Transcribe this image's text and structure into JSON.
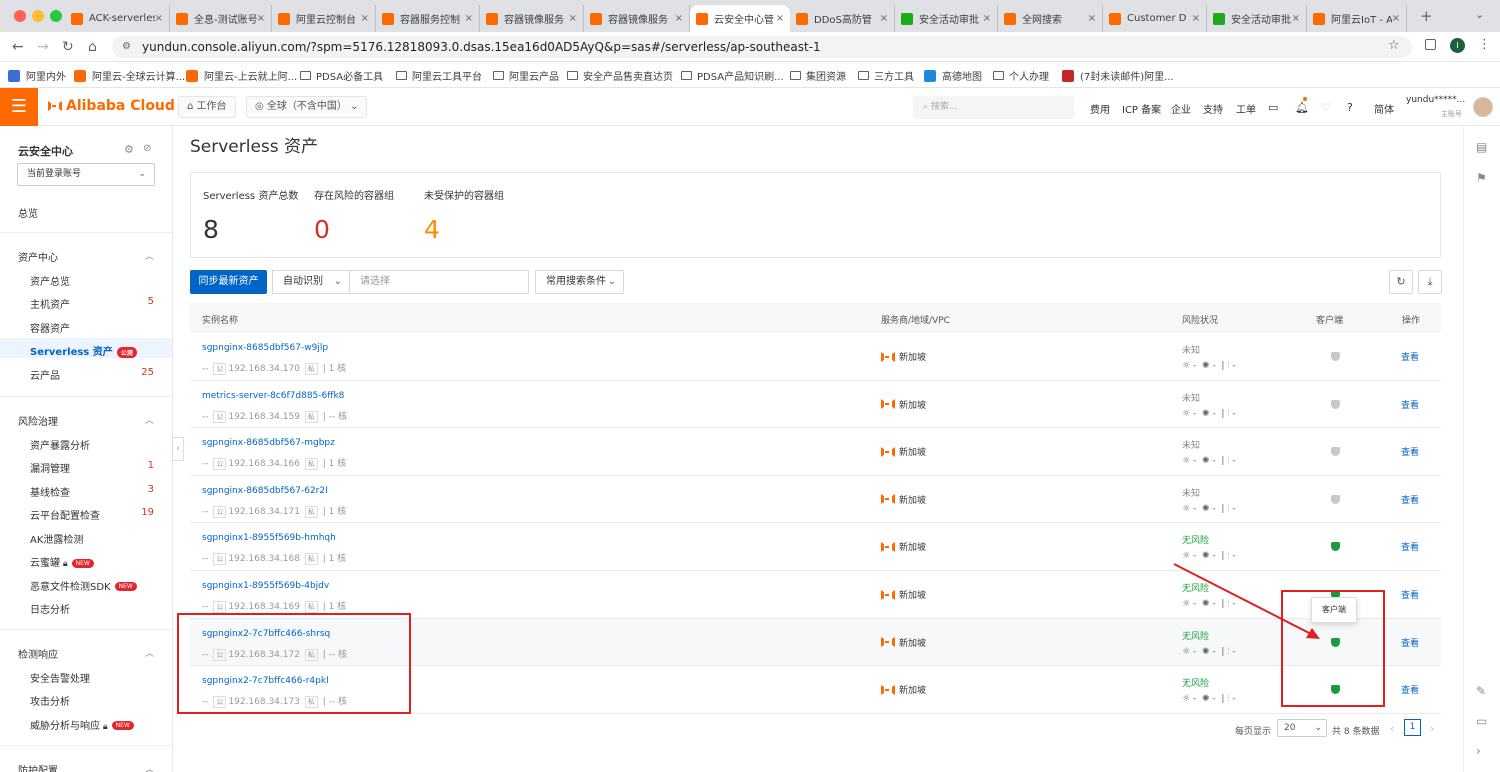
{
  "browser": {
    "tabs": [
      {
        "label": "ACK-serverless",
        "color": "#ff6a00"
      },
      {
        "label": "全息-测试账号",
        "color": "#ff6a00"
      },
      {
        "label": "阿里云控制台",
        "color": "#ff6a00"
      },
      {
        "label": "容器服务控制",
        "color": "#ff6a00"
      },
      {
        "label": "容器镜像服务",
        "color": "#ff6a00"
      },
      {
        "label": "容器镜像服务",
        "color": "#ff6a00"
      },
      {
        "label": "云安全中心管",
        "color": "#ff6a00"
      },
      {
        "label": "DDoS高防管",
        "color": "#ff6a00"
      },
      {
        "label": "安全活动审批",
        "color": "#1aad19"
      },
      {
        "label": "全网搜索",
        "color": "#ff6a00"
      },
      {
        "label": "Customer D",
        "color": "#ff6a00"
      },
      {
        "label": "安全活动审批",
        "color": "#1aad19"
      },
      {
        "label": "阿里云IoT - A",
        "color": "#ff6a00"
      }
    ],
    "url": "yundun.console.aliyun.com/?spm=5176.12818093.0.dsas.15ea16d0AD5AyQ&p=sas#/serverless/ap-southeast-1",
    "bookmarks": [
      "阿里内外",
      "阿里云-全球云计算...",
      "阿里云-上云就上阿...",
      "PDSA必备工具",
      "阿里云工具平台",
      "阿里云产品",
      "安全产品售卖直达页",
      "PDSA产品知识刷...",
      "集团资源",
      "三方工具",
      "高德地图",
      "个人办理",
      "(7封未读邮件)阿里..."
    ]
  },
  "console": {
    "brand": "Alibaba Cloud",
    "workbench": "工作台",
    "region": "全球（不含中国）",
    "search_placeholder": "搜索...",
    "links": [
      "费用",
      "ICP 备案",
      "企业",
      "支持",
      "工单",
      "简体"
    ],
    "user": "yundu*****...",
    "user_role": "主账号"
  },
  "sidebar": {
    "title": "云安全中心",
    "account_select": "当前登录账号",
    "overview": "总览",
    "sections": [
      {
        "title": "资产中心",
        "items": [
          {
            "label": "资产总览",
            "count": ""
          },
          {
            "label": "主机资产",
            "count": "5"
          },
          {
            "label": "容器资产",
            "count": ""
          },
          {
            "label": "Serverless 资产",
            "count": "",
            "badge": "公测",
            "active": true
          },
          {
            "label": "云产品",
            "count": "25"
          }
        ]
      },
      {
        "title": "风险治理",
        "items": [
          {
            "label": "资产暴露分析",
            "count": ""
          },
          {
            "label": "漏洞管理",
            "count": "1"
          },
          {
            "label": "基线检查",
            "count": "3"
          },
          {
            "label": "云平台配置检查",
            "count": "19"
          },
          {
            "label": "AK泄露检测",
            "count": ""
          },
          {
            "label": "云蜜罐",
            "count": "",
            "badge": "NEW",
            "lock": true
          },
          {
            "label": "恶意文件检测SDK",
            "count": "",
            "badge": "NEW"
          },
          {
            "label": "日志分析",
            "count": ""
          }
        ]
      },
      {
        "title": "检测响应",
        "items": [
          {
            "label": "安全告警处理",
            "count": ""
          },
          {
            "label": "攻击分析",
            "count": ""
          },
          {
            "label": "威胁分析与响应",
            "count": "",
            "badge": "NEW",
            "lock": true
          }
        ]
      },
      {
        "title": "防护配置",
        "items": []
      }
    ]
  },
  "main": {
    "title": "Serverless 资产",
    "stats": [
      {
        "label": "Serverless 资产总数",
        "value": "8",
        "color": "#333333"
      },
      {
        "label": "存在风险的容器组",
        "value": "0",
        "color": "#d93026"
      },
      {
        "label": "未受保护的容器组",
        "value": "4",
        "color": "#ff8a00"
      }
    ],
    "sync_button": "同步最新资产",
    "filter_type": "自动识别",
    "filter_placeholder": "请选择",
    "common_search": "常用搜索条件",
    "columns": [
      "实例名称",
      "服务商/地域/VPC",
      "风险状况",
      "客户端",
      "操作"
    ],
    "rows": [
      {
        "name": "sgpnginx-8685dbf567-w9jlp",
        "pub": "--",
        "priv": "192.168.34.170",
        "cores": "1 核",
        "provider": "新加坡",
        "risk": "未知",
        "client_online": false,
        "action": "查看"
      },
      {
        "name": "metrics-server-8c6f7d885-6ffk8",
        "pub": "--",
        "priv": "192.168.34.159",
        "cores": "-- 核",
        "provider": "新加坡",
        "risk": "未知",
        "client_online": false,
        "action": "查看"
      },
      {
        "name": "sgpnginx-8685dbf567-mgbpz",
        "pub": "--",
        "priv": "192.168.34.166",
        "cores": "1 核",
        "provider": "新加坡",
        "risk": "未知",
        "client_online": false,
        "action": "查看"
      },
      {
        "name": "sgpnginx-8685dbf567-62r2l",
        "pub": "--",
        "priv": "192.168.34.171",
        "cores": "1 核",
        "provider": "新加坡",
        "risk": "未知",
        "client_online": false,
        "action": "查看"
      },
      {
        "name": "sgpnginx1-8955f569b-hmhqh",
        "pub": "--",
        "priv": "192.168.34.168",
        "cores": "1 核",
        "provider": "新加坡",
        "risk": "无风险",
        "client_online": true,
        "action": "查看"
      },
      {
        "name": "sgpnginx1-8955f569b-4bjdv",
        "pub": "--",
        "priv": "192.168.34.169",
        "cores": "1 核",
        "provider": "新加坡",
        "risk": "无风险",
        "client_online": true,
        "action": "查看"
      },
      {
        "name": "sgpnginx2-7c7bffc466-shrsq",
        "pub": "--",
        "priv": "192.168.34.172",
        "cores": "-- 核",
        "provider": "新加坡",
        "risk": "无风险",
        "client_online": true,
        "action": "查看"
      },
      {
        "name": "sgpnginx2-7c7bffc466-r4pkl",
        "pub": "--",
        "priv": "192.168.34.173",
        "cores": "-- 核",
        "provider": "新加坡",
        "risk": "无风险",
        "client_online": true,
        "action": "查看"
      }
    ],
    "tag_public": "公",
    "tag_private": "私",
    "risk_dash": "-",
    "tooltip": "客户端",
    "pager": {
      "per_page_label": "每页显示",
      "per_page": "20",
      "total": "共 8 条数据",
      "current": "1"
    }
  }
}
